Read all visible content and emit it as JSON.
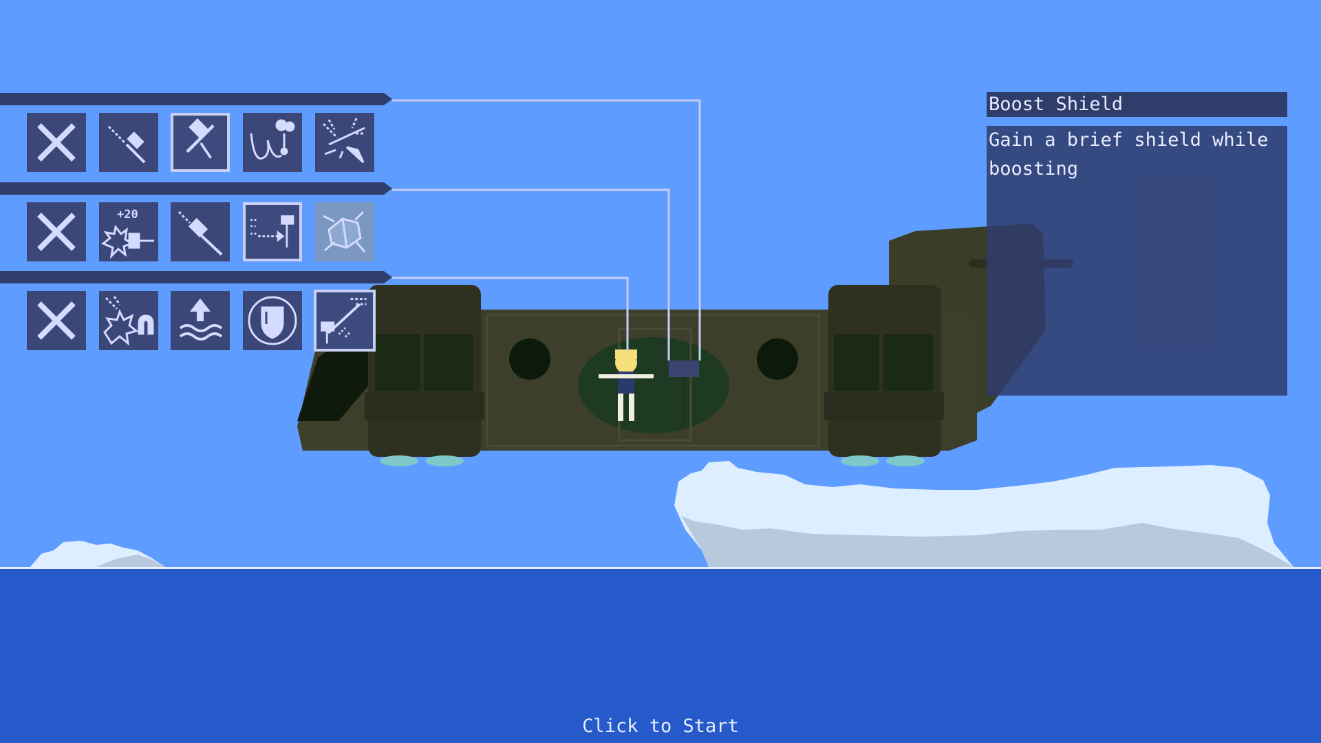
{
  "info_panel": {
    "title": "Boost Shield",
    "description": "Gain a brief shield while\nboosting"
  },
  "prompt": "Click to Start",
  "rows": [
    {
      "slots": [
        {
          "icon": "x-icon",
          "state": "normal"
        },
        {
          "icon": "laser-hammer-icon",
          "state": "normal"
        },
        {
          "icon": "hammer-drop-icon",
          "state": "selected"
        },
        {
          "icon": "swing-bomb-icon",
          "state": "normal"
        },
        {
          "icon": "spark-drill-icon",
          "state": "normal"
        }
      ]
    },
    {
      "slots": [
        {
          "icon": "x-icon",
          "state": "normal"
        },
        {
          "icon": "plus-twenty-burst-icon",
          "state": "normal",
          "label": "+20"
        },
        {
          "icon": "rocket-hammer-icon",
          "state": "normal"
        },
        {
          "icon": "dash-hammer-icon",
          "state": "selected"
        },
        {
          "icon": "crackle-orb-icon",
          "state": "locked"
        }
      ]
    },
    {
      "slots": [
        {
          "icon": "x-icon",
          "state": "normal"
        },
        {
          "icon": "explosion-magnet-icon",
          "state": "normal"
        },
        {
          "icon": "water-jump-icon",
          "state": "normal"
        },
        {
          "icon": "shield-icon",
          "state": "normal"
        },
        {
          "icon": "boost-shield-icon",
          "state": "selected"
        }
      ]
    }
  ],
  "colors": {
    "sky": "#5f9cff",
    "sea": "#2659c9",
    "panel": "#2f3d6b",
    "slot": "#3a4778",
    "icon": "#d5dbff",
    "helicopter": "#3d3f2b",
    "cloud": "#dceeff"
  }
}
